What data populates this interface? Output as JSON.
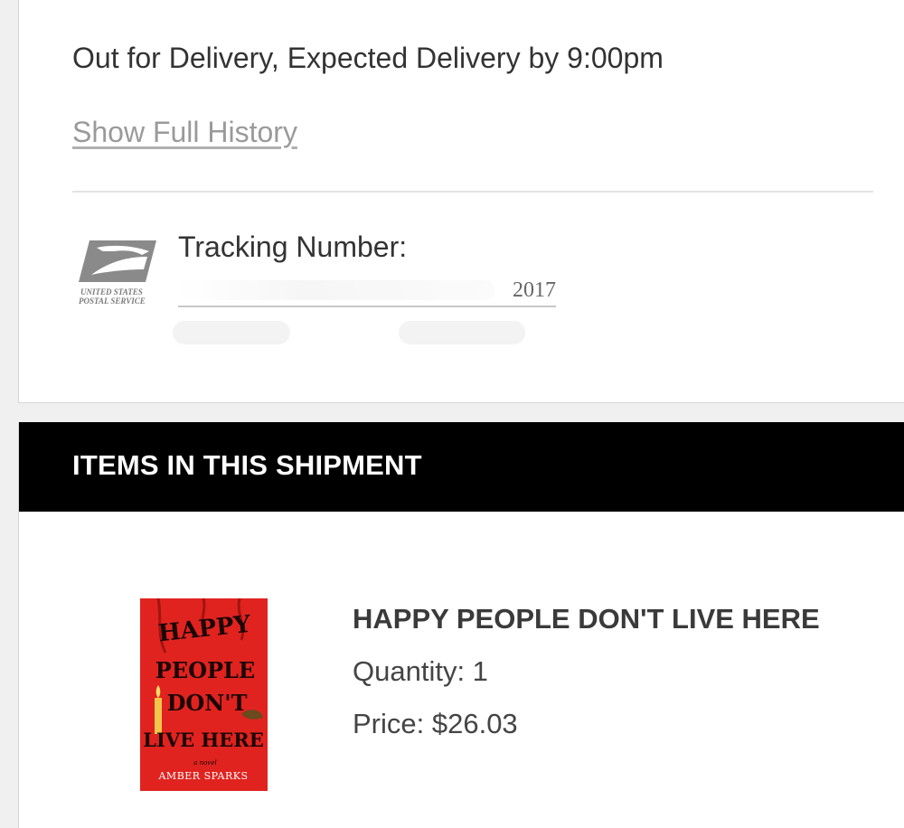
{
  "tracking": {
    "status": "Out for Delivery, Expected Delivery by 9:00pm",
    "history_link": "Show Full History",
    "carrier_name_line1": "UNITED STATES",
    "carrier_name_line2": "POSTAL SERVICE",
    "tracking_label": "Tracking Number:",
    "tracking_suffix": "2017",
    "carrier_logo_icon": "usps-eagle-icon",
    "carrier_logo_color": "#7a7a7a"
  },
  "shipment": {
    "header": "ITEMS IN THIS SHIPMENT",
    "header_bg": "#000000",
    "items": [
      {
        "name": "HAPPY PEOPLE DON'T LIVE HERE",
        "quantity": "Quantity: 1",
        "price": "Price: $26.03",
        "cover": {
          "title_lines": [
            "HAPPY",
            "PEOPLE",
            "DON'T",
            "LIVE HERE"
          ],
          "tagline": "a novel",
          "author": "AMBER SPARKS",
          "background": "#e0231f"
        }
      }
    ]
  }
}
